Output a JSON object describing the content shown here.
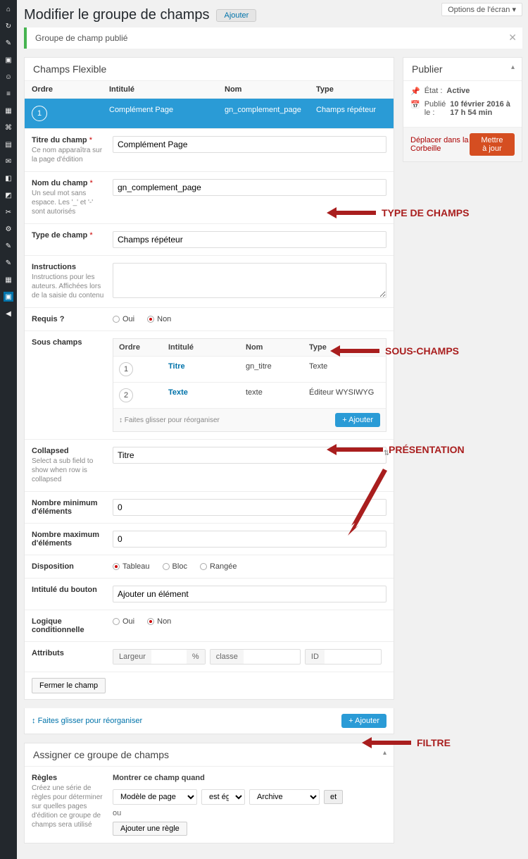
{
  "screen_options": "Options de l'écran ▾",
  "page_title": "Modifier le groupe de champs",
  "add_new_btn": "Ajouter",
  "notice_published": "Groupe de champ publié",
  "postbox_title": "Champs Flexible",
  "field_headers": {
    "ordre": "Ordre",
    "intitule": "Intitulé",
    "nom": "Nom",
    "type": "Type"
  },
  "active_field": {
    "num": "1",
    "intitule": "Complément Page",
    "nom": "gn_complement_page",
    "type": "Champs répéteur"
  },
  "settings": {
    "titre": {
      "label": "Titre du champ",
      "desc": "Ce nom apparaîtra sur la page d'édition",
      "value": "Complément Page"
    },
    "nom": {
      "label": "Nom du champ",
      "desc": "Un seul mot sans espace. Les '_' et '-' sont autorisés",
      "value": "gn_complement_page"
    },
    "type": {
      "label": "Type de champ",
      "value": "Champs répéteur"
    },
    "instructions": {
      "label": "Instructions",
      "desc": "Instructions pour les auteurs. Affichées lors de la saisie du contenu",
      "value": ""
    },
    "requis": {
      "label": "Requis ?",
      "oui": "Oui",
      "non": "Non"
    },
    "sous_champs": {
      "label": "Sous champs"
    },
    "collapsed": {
      "label": "Collapsed",
      "desc": "Select a sub field to show when row is collapsed",
      "value": "Titre"
    },
    "min": {
      "label": "Nombre minimum d'éléments",
      "value": "0"
    },
    "max": {
      "label": "Nombre maximum d'éléments",
      "value": "0"
    },
    "disposition": {
      "label": "Disposition",
      "tableau": "Tableau",
      "bloc": "Bloc",
      "rangee": "Rangée"
    },
    "bouton": {
      "label": "Intitulé du bouton",
      "value": "Ajouter un élément"
    },
    "logique": {
      "label": "Logique conditionnelle",
      "oui": "Oui",
      "non": "Non"
    },
    "attributs": {
      "label": "Attributs",
      "largeur": "Largeur",
      "pct": "%",
      "classe": "classe",
      "id": "ID"
    },
    "close": "Fermer le champ"
  },
  "subfields": {
    "headers": {
      "ordre": "Ordre",
      "intitule": "Intitulé",
      "nom": "Nom",
      "type": "Type"
    },
    "rows": [
      {
        "num": "1",
        "intitule": "Titre",
        "nom": "gn_titre",
        "type": "Texte"
      },
      {
        "num": "2",
        "intitule": "Texte",
        "nom": "texte",
        "type": "Éditeur WYSIWYG"
      }
    ],
    "drag_hint": "Faites glisser pour réorganiser",
    "add": "+ Ajouter"
  },
  "main_drag_hint": "Faites glisser pour réorganiser",
  "main_add": "+ Ajouter",
  "location": {
    "title": "Assigner ce groupe de champs",
    "rules_label": "Règles",
    "rules_desc": "Créez une série de règles pour déterminer sur quelles pages d'édition ce groupe de champs sera utilisé",
    "show_when": "Montrer ce champ quand",
    "param": "Modèle de page",
    "operator": "est égal à",
    "value": "Archive",
    "and": "et",
    "or": "ou",
    "add_rule": "Ajouter une règle"
  },
  "publish": {
    "title": "Publier",
    "state_label": "État :",
    "state_value": "Active",
    "pub_label": "Publié le :",
    "pub_value": "10 février 2016 à 17 h 54 min",
    "trash": "Déplacer dans la Corbeille",
    "update": "Mettre à jour"
  },
  "annotations": {
    "type": "TYPE DE CHAMPS",
    "sous": "SOUS-CHAMPS",
    "pres": "PRÉSENTATION",
    "filtre": "FILTRE"
  }
}
